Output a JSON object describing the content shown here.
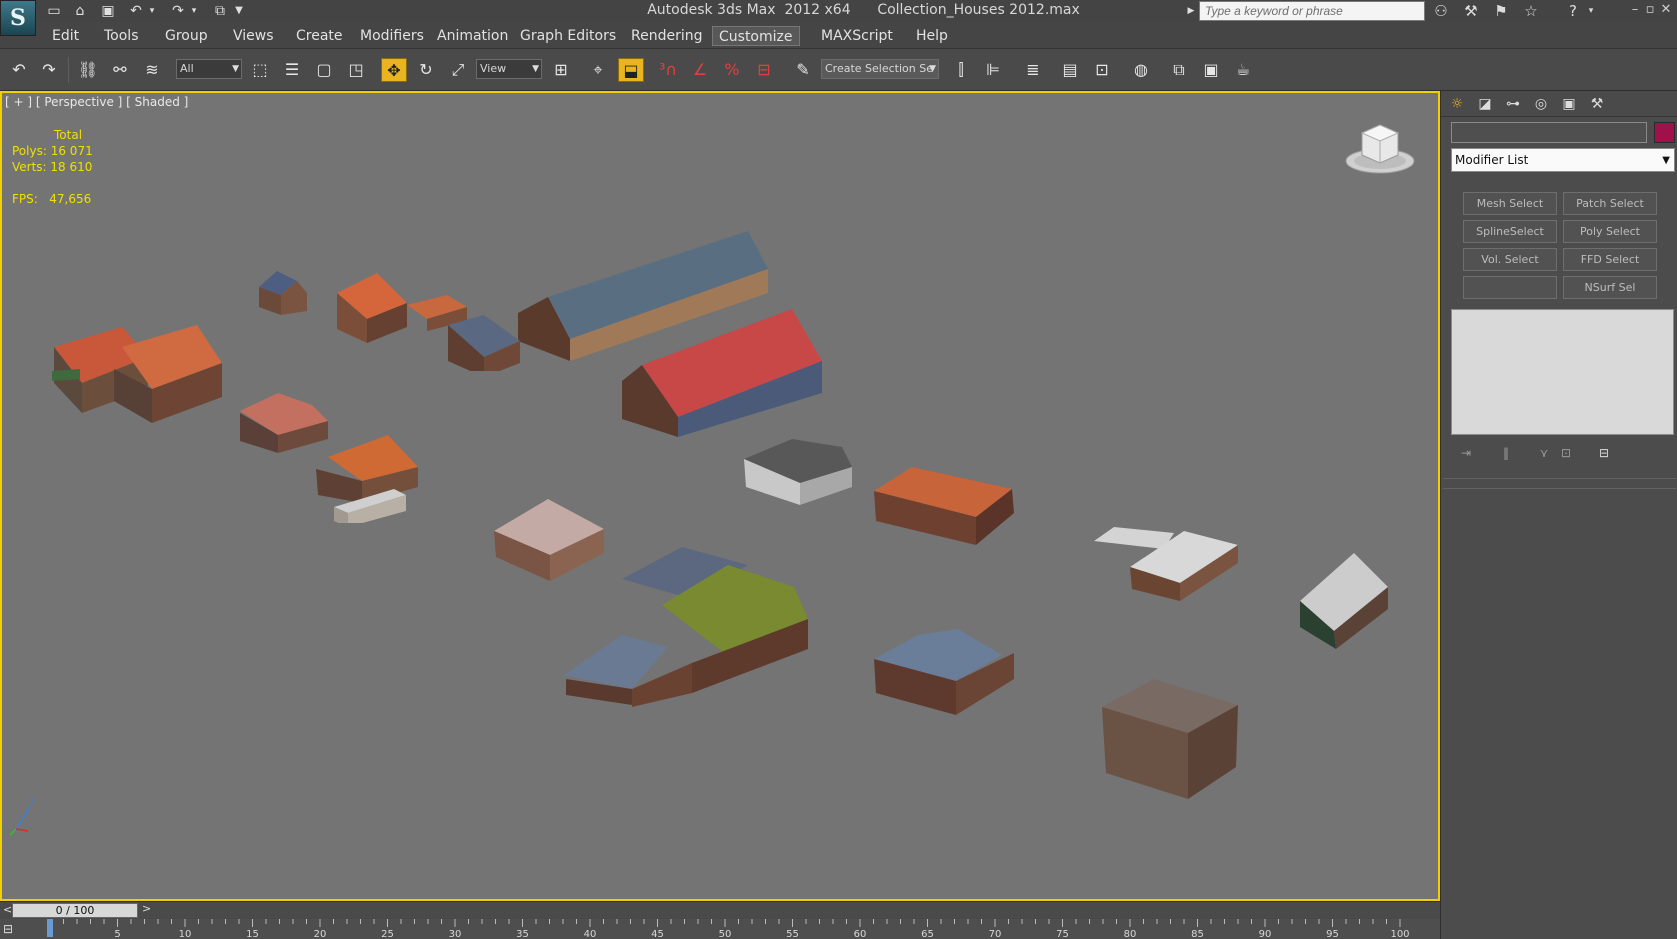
{
  "app": {
    "logo": "S",
    "title": "Autodesk 3ds Max  2012 x64      Collection_Houses 2012.max"
  },
  "quick_access": [
    "new-file-icon",
    "open-file-icon",
    "save-icon",
    "undo-icon",
    "redo-icon",
    "project-folder-icon"
  ],
  "search": {
    "placeholder": "Type a keyword or phrase"
  },
  "menu": [
    "Edit",
    "Tools",
    "Group",
    "Views",
    "Create",
    "Modifiers",
    "Animation",
    "Graph Editors",
    "Rendering",
    "Customize",
    "MAXScript",
    "Help"
  ],
  "menu_active": "Customize",
  "toolbar": {
    "selection_filter": "All",
    "ref_coord": "View",
    "named_selection": "Create Selection Se",
    "active_tool": "select-and-move-icon"
  },
  "viewport": {
    "label": "[ + ] [ Perspective ] [ Shaded ]",
    "stats": {
      "total_label": "Total",
      "polys_label": "Polys:",
      "polys_value": "16 071",
      "verts_label": "Verts:",
      "verts_value": "18 610",
      "fps_label": "FPS:",
      "fps_value": "47,656"
    },
    "border_color": "#f0d000",
    "background_color": "#747474"
  },
  "command_panel": {
    "tabs": [
      "create-tab-icon",
      "modify-tab-icon",
      "hierarchy-tab-icon",
      "motion-tab-icon",
      "display-tab-icon",
      "utilities-tab-icon"
    ],
    "name_value": "",
    "object_color": "#a0104a",
    "modifier_list": "Modifier List",
    "modifier_buttons": [
      [
        "Mesh Select",
        "Patch Select"
      ],
      [
        "SplineSelect",
        "Poly Select"
      ],
      [
        "Vol. Select",
        "FFD Select"
      ],
      [
        "",
        "NSurf Sel"
      ]
    ]
  },
  "timeline": {
    "frame": "0 / 100",
    "prev": "<",
    "next": ">",
    "ticks": [
      "5",
      "10",
      "15",
      "20",
      "25",
      "30",
      "35",
      "40",
      "45",
      "50",
      "55",
      "60",
      "65",
      "70",
      "75",
      "80",
      "85",
      "90",
      "95",
      "100"
    ]
  }
}
